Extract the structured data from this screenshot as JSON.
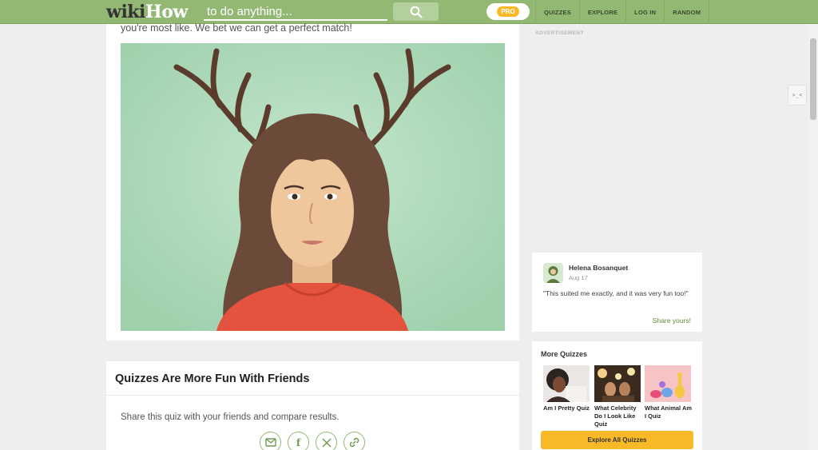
{
  "header": {
    "logo_part1": "wiki",
    "logo_part2": "How",
    "search_placeholder": "to do anything...",
    "pro_label": "PRO",
    "nav": [
      "QUIZZES",
      "EXPLORE",
      "LOG IN",
      "RANDOM"
    ]
  },
  "main": {
    "intro_text": "you're most like. We bet we can get a perfect match!"
  },
  "share": {
    "title": "Quizzes Are More Fun With Friends",
    "text": "Share this quiz with your friends and compare results.",
    "icons": [
      "email-icon",
      "facebook-icon",
      "x-icon",
      "link-icon"
    ]
  },
  "sidebar": {
    "ad_label": "ADVERTISEMENT",
    "review": {
      "name": "Helena Bosanquet",
      "date": "Aug 17",
      "text": "\"This suited me exactly, and it was very fun too!\"",
      "share_link": "Share yours!"
    },
    "more_quizzes": {
      "title": "More Quizzes",
      "items": [
        {
          "label": "Am I Pretty Quiz"
        },
        {
          "label": "What Celebrity Do I Look Like Quiz"
        },
        {
          "label": "What Animal Am I Quiz"
        }
      ],
      "explore_label": "Explore All Quizzes"
    }
  },
  "colors": {
    "brand_green": "#93b874",
    "link_green": "#5f8a3a",
    "accent_yellow": "#f8b928"
  }
}
